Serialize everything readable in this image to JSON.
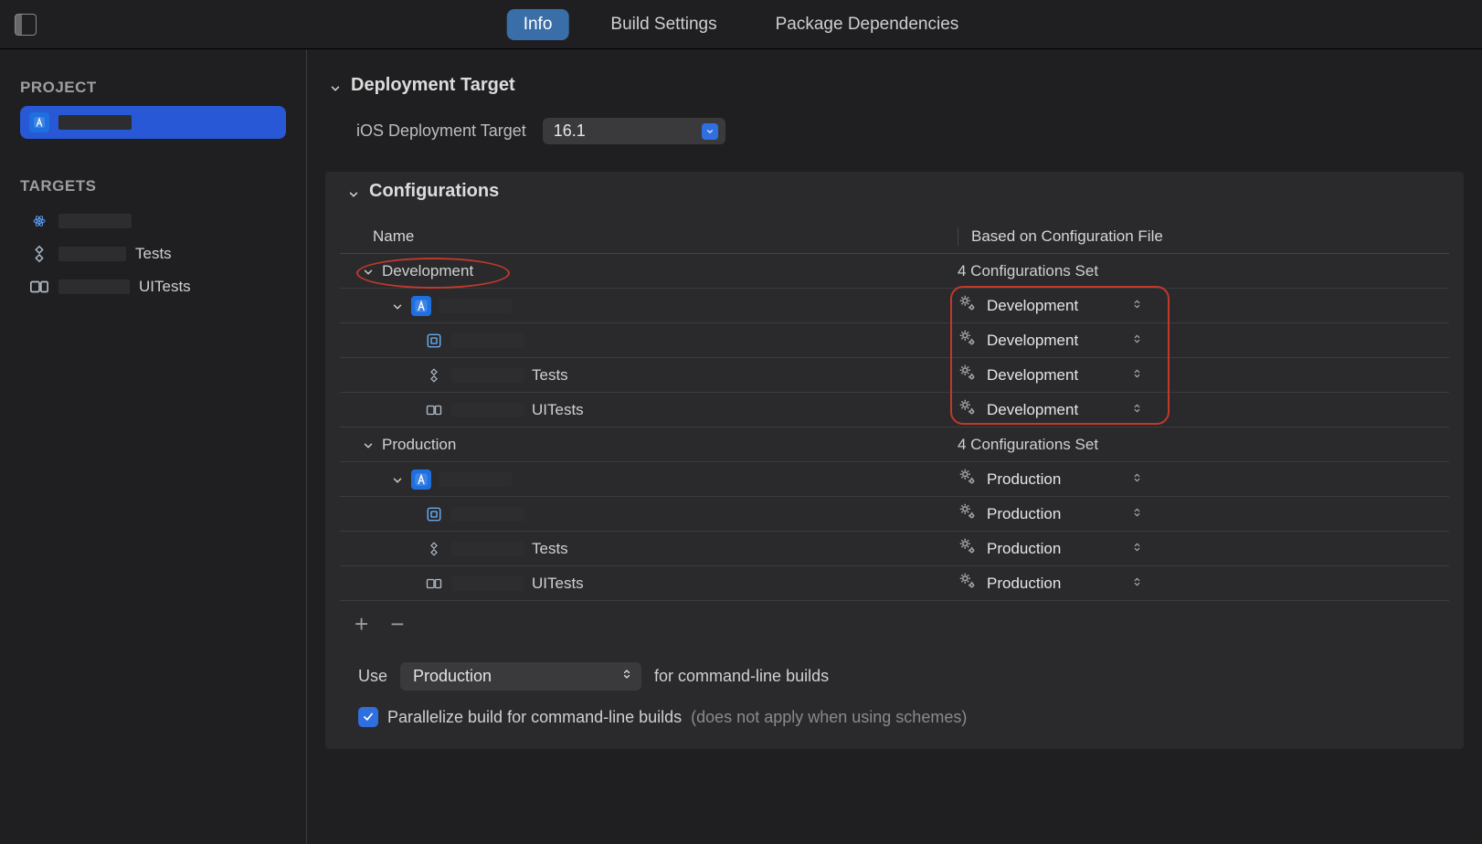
{
  "tabs": {
    "info": "Info",
    "build_settings": "Build Settings",
    "package_deps": "Package Dependencies"
  },
  "sidebar": {
    "project_label": "PROJECT",
    "targets_label": "TARGETS",
    "project_item": "",
    "targets": [
      {
        "name": "",
        "suffix": ""
      },
      {
        "name": "",
        "suffix": "Tests"
      },
      {
        "name": "",
        "suffix": "UITests"
      }
    ]
  },
  "deployment": {
    "section": "Deployment Target",
    "label": "iOS Deployment Target",
    "value": "16.1"
  },
  "configurations": {
    "section": "Configurations",
    "col_name": "Name",
    "col_file": "Based on Configuration File",
    "groups": [
      {
        "name": "Development",
        "summary": "4 Configurations Set",
        "rows": [
          {
            "indent": 1,
            "icon": "app",
            "label": "",
            "suffix": "",
            "config": "Development"
          },
          {
            "indent": 2,
            "icon": "fw",
            "label": "",
            "suffix": "",
            "config": "Development"
          },
          {
            "indent": 2,
            "icon": "diamond",
            "label": "",
            "suffix": "Tests",
            "config": "Development"
          },
          {
            "indent": 2,
            "icon": "ui",
            "label": "",
            "suffix": "UITests",
            "config": "Development"
          }
        ]
      },
      {
        "name": "Production",
        "summary": "4 Configurations Set",
        "rows": [
          {
            "indent": 1,
            "icon": "app",
            "label": "",
            "suffix": "",
            "config": "Production"
          },
          {
            "indent": 2,
            "icon": "fw",
            "label": "",
            "suffix": "",
            "config": "Production"
          },
          {
            "indent": 2,
            "icon": "diamond",
            "label": "",
            "suffix": "Tests",
            "config": "Production"
          },
          {
            "indent": 2,
            "icon": "ui",
            "label": "",
            "suffix": "UITests",
            "config": "Production"
          }
        ]
      }
    ],
    "use_label": "Use",
    "use_value": "Production",
    "use_suffix": "for command-line builds",
    "parallelize": "Parallelize build for command-line builds",
    "parallelize_note": "(does not apply when using schemes)"
  }
}
